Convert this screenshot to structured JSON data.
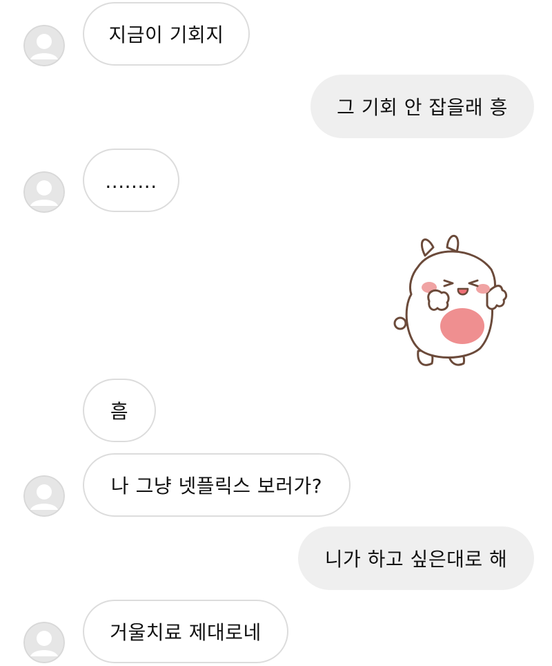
{
  "chat": {
    "messages": [
      {
        "sender": "them",
        "text": "지금이 기회지"
      },
      {
        "sender": "me",
        "text": "그 기회 안 잡을래 흥"
      },
      {
        "sender": "them",
        "text": "........"
      },
      {
        "sender": "me",
        "sticker": "white-bunny-waving-sticker"
      },
      {
        "sender": "them",
        "text": "흠"
      },
      {
        "sender": "them",
        "text": "나 그냥 넷플릭스 보러가?"
      },
      {
        "sender": "me",
        "text": "니가 하고 싶은대로 해"
      },
      {
        "sender": "them",
        "text": "거울치료 제대로네"
      }
    ]
  },
  "colors": {
    "incoming_bubble_bg": "#ffffff",
    "incoming_bubble_border": "#dcdcdc",
    "outgoing_bubble_bg": "#efefef",
    "avatar_placeholder": "#d4d4d4",
    "text": "#111111"
  },
  "icons": {
    "avatar": "default-profile-avatar-icon"
  }
}
